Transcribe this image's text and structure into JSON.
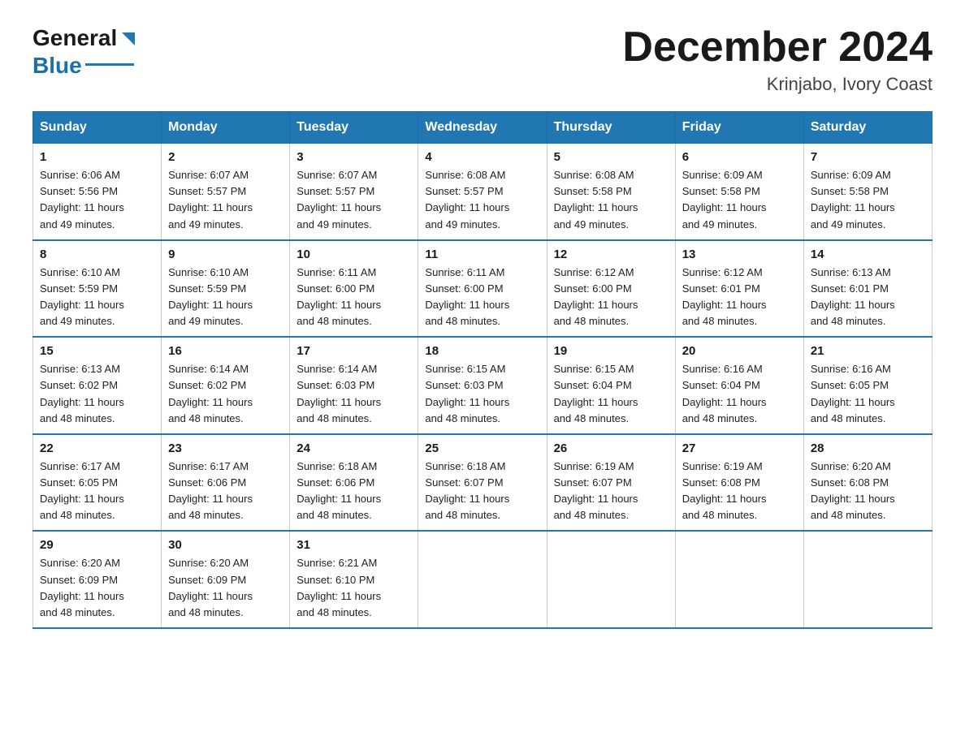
{
  "header": {
    "logo_general": "General",
    "logo_blue": "Blue",
    "month_title": "December 2024",
    "location": "Krinjabo, Ivory Coast"
  },
  "days_of_week": [
    "Sunday",
    "Monday",
    "Tuesday",
    "Wednesday",
    "Thursday",
    "Friday",
    "Saturday"
  ],
  "weeks": [
    [
      {
        "day": "1",
        "sunrise": "6:06 AM",
        "sunset": "5:56 PM",
        "daylight": "11 hours and 49 minutes."
      },
      {
        "day": "2",
        "sunrise": "6:07 AM",
        "sunset": "5:57 PM",
        "daylight": "11 hours and 49 minutes."
      },
      {
        "day": "3",
        "sunrise": "6:07 AM",
        "sunset": "5:57 PM",
        "daylight": "11 hours and 49 minutes."
      },
      {
        "day": "4",
        "sunrise": "6:08 AM",
        "sunset": "5:57 PM",
        "daylight": "11 hours and 49 minutes."
      },
      {
        "day": "5",
        "sunrise": "6:08 AM",
        "sunset": "5:58 PM",
        "daylight": "11 hours and 49 minutes."
      },
      {
        "day": "6",
        "sunrise": "6:09 AM",
        "sunset": "5:58 PM",
        "daylight": "11 hours and 49 minutes."
      },
      {
        "day": "7",
        "sunrise": "6:09 AM",
        "sunset": "5:58 PM",
        "daylight": "11 hours and 49 minutes."
      }
    ],
    [
      {
        "day": "8",
        "sunrise": "6:10 AM",
        "sunset": "5:59 PM",
        "daylight": "11 hours and 49 minutes."
      },
      {
        "day": "9",
        "sunrise": "6:10 AM",
        "sunset": "5:59 PM",
        "daylight": "11 hours and 49 minutes."
      },
      {
        "day": "10",
        "sunrise": "6:11 AM",
        "sunset": "6:00 PM",
        "daylight": "11 hours and 48 minutes."
      },
      {
        "day": "11",
        "sunrise": "6:11 AM",
        "sunset": "6:00 PM",
        "daylight": "11 hours and 48 minutes."
      },
      {
        "day": "12",
        "sunrise": "6:12 AM",
        "sunset": "6:00 PM",
        "daylight": "11 hours and 48 minutes."
      },
      {
        "day": "13",
        "sunrise": "6:12 AM",
        "sunset": "6:01 PM",
        "daylight": "11 hours and 48 minutes."
      },
      {
        "day": "14",
        "sunrise": "6:13 AM",
        "sunset": "6:01 PM",
        "daylight": "11 hours and 48 minutes."
      }
    ],
    [
      {
        "day": "15",
        "sunrise": "6:13 AM",
        "sunset": "6:02 PM",
        "daylight": "11 hours and 48 minutes."
      },
      {
        "day": "16",
        "sunrise": "6:14 AM",
        "sunset": "6:02 PM",
        "daylight": "11 hours and 48 minutes."
      },
      {
        "day": "17",
        "sunrise": "6:14 AM",
        "sunset": "6:03 PM",
        "daylight": "11 hours and 48 minutes."
      },
      {
        "day": "18",
        "sunrise": "6:15 AM",
        "sunset": "6:03 PM",
        "daylight": "11 hours and 48 minutes."
      },
      {
        "day": "19",
        "sunrise": "6:15 AM",
        "sunset": "6:04 PM",
        "daylight": "11 hours and 48 minutes."
      },
      {
        "day": "20",
        "sunrise": "6:16 AM",
        "sunset": "6:04 PM",
        "daylight": "11 hours and 48 minutes."
      },
      {
        "day": "21",
        "sunrise": "6:16 AM",
        "sunset": "6:05 PM",
        "daylight": "11 hours and 48 minutes."
      }
    ],
    [
      {
        "day": "22",
        "sunrise": "6:17 AM",
        "sunset": "6:05 PM",
        "daylight": "11 hours and 48 minutes."
      },
      {
        "day": "23",
        "sunrise": "6:17 AM",
        "sunset": "6:06 PM",
        "daylight": "11 hours and 48 minutes."
      },
      {
        "day": "24",
        "sunrise": "6:18 AM",
        "sunset": "6:06 PM",
        "daylight": "11 hours and 48 minutes."
      },
      {
        "day": "25",
        "sunrise": "6:18 AM",
        "sunset": "6:07 PM",
        "daylight": "11 hours and 48 minutes."
      },
      {
        "day": "26",
        "sunrise": "6:19 AM",
        "sunset": "6:07 PM",
        "daylight": "11 hours and 48 minutes."
      },
      {
        "day": "27",
        "sunrise": "6:19 AM",
        "sunset": "6:08 PM",
        "daylight": "11 hours and 48 minutes."
      },
      {
        "day": "28",
        "sunrise": "6:20 AM",
        "sunset": "6:08 PM",
        "daylight": "11 hours and 48 minutes."
      }
    ],
    [
      {
        "day": "29",
        "sunrise": "6:20 AM",
        "sunset": "6:09 PM",
        "daylight": "11 hours and 48 minutes."
      },
      {
        "day": "30",
        "sunrise": "6:20 AM",
        "sunset": "6:09 PM",
        "daylight": "11 hours and 48 minutes."
      },
      {
        "day": "31",
        "sunrise": "6:21 AM",
        "sunset": "6:10 PM",
        "daylight": "11 hours and 48 minutes."
      },
      null,
      null,
      null,
      null
    ]
  ],
  "labels": {
    "sunrise": "Sunrise:",
    "sunset": "Sunset:",
    "daylight": "Daylight:"
  }
}
